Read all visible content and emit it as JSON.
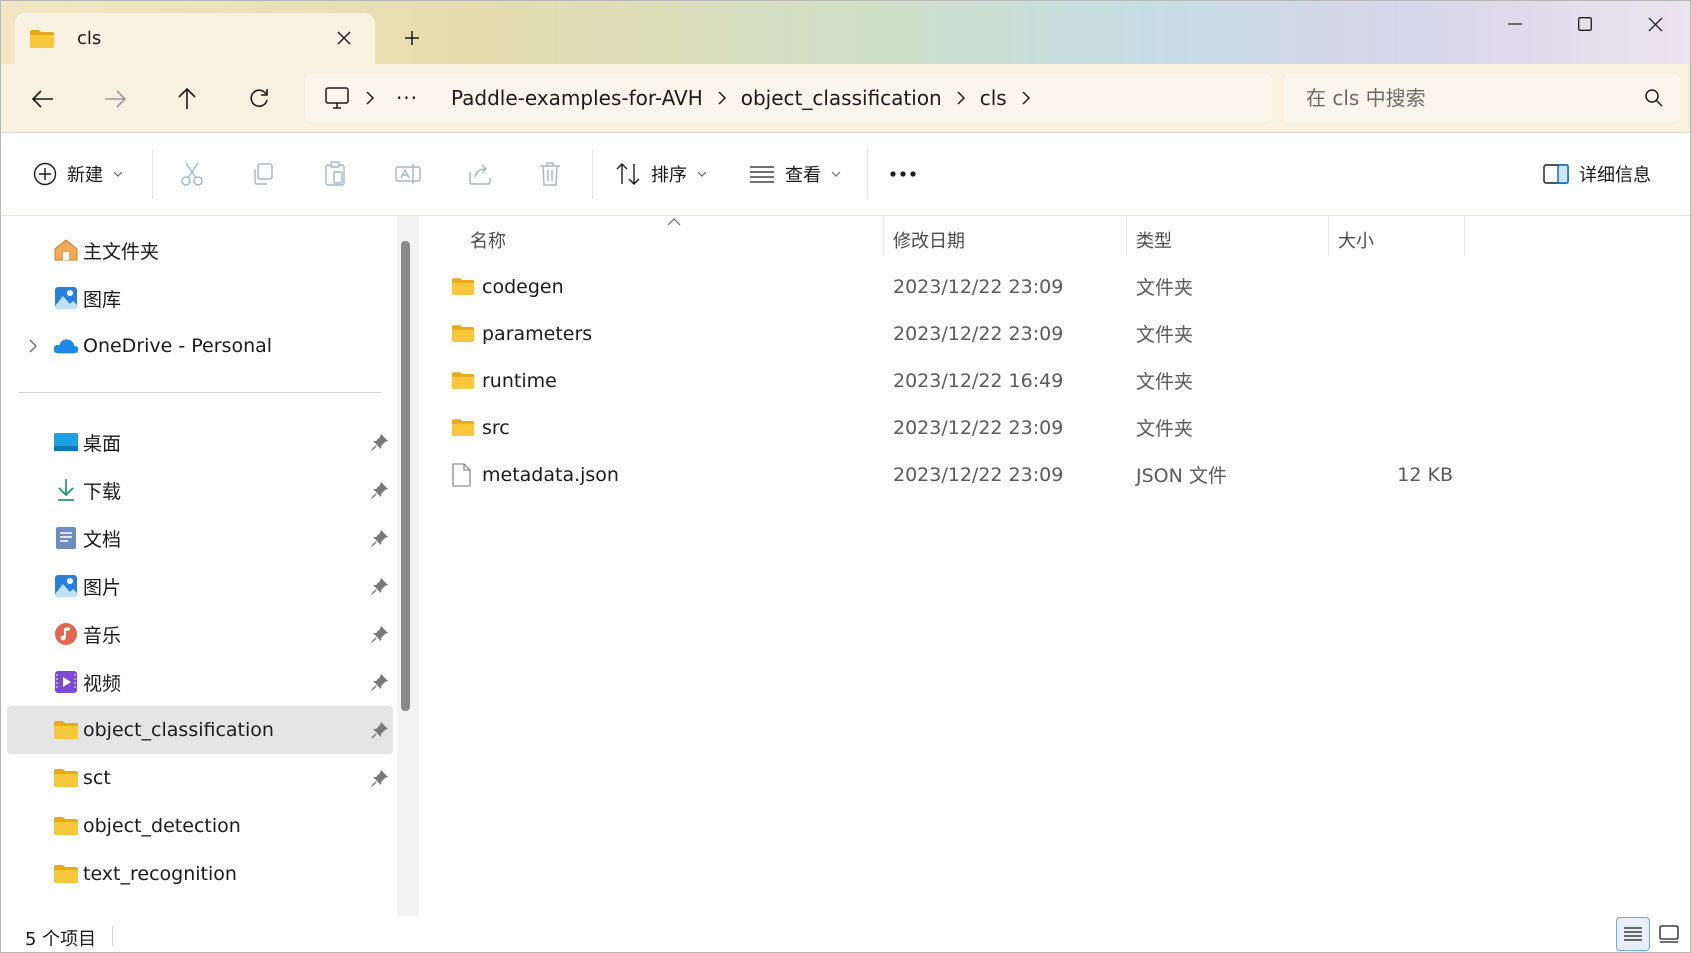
{
  "window": {
    "tab_title": "cls",
    "new_tab_label": "+"
  },
  "nav": {
    "breadcrumb": {
      "overflow": "···",
      "items": [
        "Paddle-examples-for-AVH",
        "object_classification",
        "cls"
      ]
    },
    "search_placeholder": "在 cls 中搜索"
  },
  "toolbar": {
    "new_label": "新建",
    "sort_label": "排序",
    "view_label": "查看",
    "more_label": "···",
    "details_label": "详细信息"
  },
  "sidebar": {
    "top_items": [
      {
        "label": "主文件夹",
        "icon": "home-icon"
      },
      {
        "label": "图库",
        "icon": "gallery-icon"
      },
      {
        "label": "OneDrive - Personal",
        "icon": "onedrive-icon"
      }
    ],
    "pinned_items": [
      {
        "label": "桌面",
        "icon": "desktop-icon",
        "pinned": true
      },
      {
        "label": "下载",
        "icon": "download-icon",
        "pinned": true
      },
      {
        "label": "文档",
        "icon": "documents-icon",
        "pinned": true
      },
      {
        "label": "图片",
        "icon": "pictures-icon",
        "pinned": true
      },
      {
        "label": "音乐",
        "icon": "music-icon",
        "pinned": true
      },
      {
        "label": "视频",
        "icon": "videos-icon",
        "pinned": true
      },
      {
        "label": "object_classification",
        "icon": "folder-icon",
        "pinned": true,
        "selected": true
      },
      {
        "label": "sct",
        "icon": "folder-icon",
        "pinned": true
      },
      {
        "label": "object_detection",
        "icon": "folder-icon",
        "pinned": false
      },
      {
        "label": "text_recognition",
        "icon": "folder-icon",
        "pinned": false
      }
    ]
  },
  "file_list": {
    "columns": [
      "名称",
      "修改日期",
      "类型",
      "大小"
    ],
    "rows": [
      {
        "name": "codegen",
        "date": "2023/12/22 23:09",
        "type": "文件夹",
        "size": "",
        "icon": "folder-icon"
      },
      {
        "name": "parameters",
        "date": "2023/12/22 23:09",
        "type": "文件夹",
        "size": "",
        "icon": "folder-icon"
      },
      {
        "name": "runtime",
        "date": "2023/12/22 16:49",
        "type": "文件夹",
        "size": "",
        "icon": "folder-icon"
      },
      {
        "name": "src",
        "date": "2023/12/22 23:09",
        "type": "文件夹",
        "size": "",
        "icon": "folder-icon"
      },
      {
        "name": "metadata.json",
        "date": "2023/12/22 23:09",
        "type": "JSON 文件",
        "size": "12 KB",
        "icon": "file-icon"
      }
    ]
  },
  "status": {
    "item_count": "5 个项目"
  },
  "colors": {
    "folder_yellow": "#f8c73b",
    "folder_yellow_dark": "#e8a91c",
    "selection_gray": "#e5e5e5",
    "accent_blue": "#0067c0"
  }
}
